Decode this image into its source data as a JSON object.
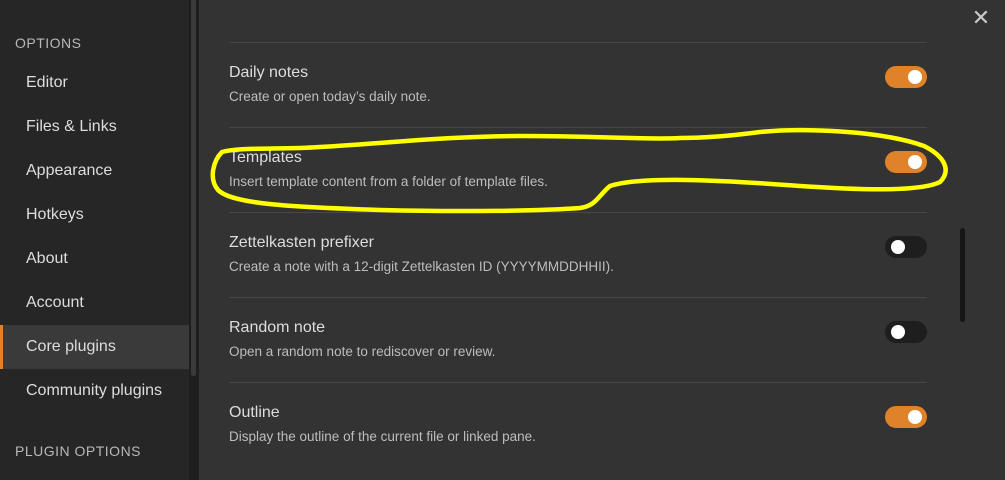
{
  "sidebar": {
    "options_heading": "OPTIONS",
    "items": [
      {
        "label": "Editor"
      },
      {
        "label": "Files & Links"
      },
      {
        "label": "Appearance"
      },
      {
        "label": "Hotkeys"
      },
      {
        "label": "About"
      },
      {
        "label": "Account"
      },
      {
        "label": "Core plugins",
        "active": true
      },
      {
        "label": "Community plugins"
      }
    ],
    "plugin_options_heading": "PLUGIN OPTIONS"
  },
  "window": {
    "close_icon": "close-icon",
    "close_glyph": "✕"
  },
  "settings": [
    {
      "name": "Daily notes",
      "description": "Create or open today’s daily note.",
      "enabled": true
    },
    {
      "name": "Templates",
      "description": "Insert template content from a folder of template files.",
      "enabled": true
    },
    {
      "name": "Zettelkasten prefixer",
      "description": "Create a note with a 12-digit Zettelkasten ID (YYYYMMDDHHII).",
      "enabled": false
    },
    {
      "name": "Random note",
      "description": "Open a random note to rediscover or review.",
      "enabled": false
    },
    {
      "name": "Outline",
      "description": "Display the outline of the current file or linked pane.",
      "enabled": true
    }
  ],
  "colors": {
    "accent": "#e0822a",
    "annotation": "#ffff00"
  }
}
